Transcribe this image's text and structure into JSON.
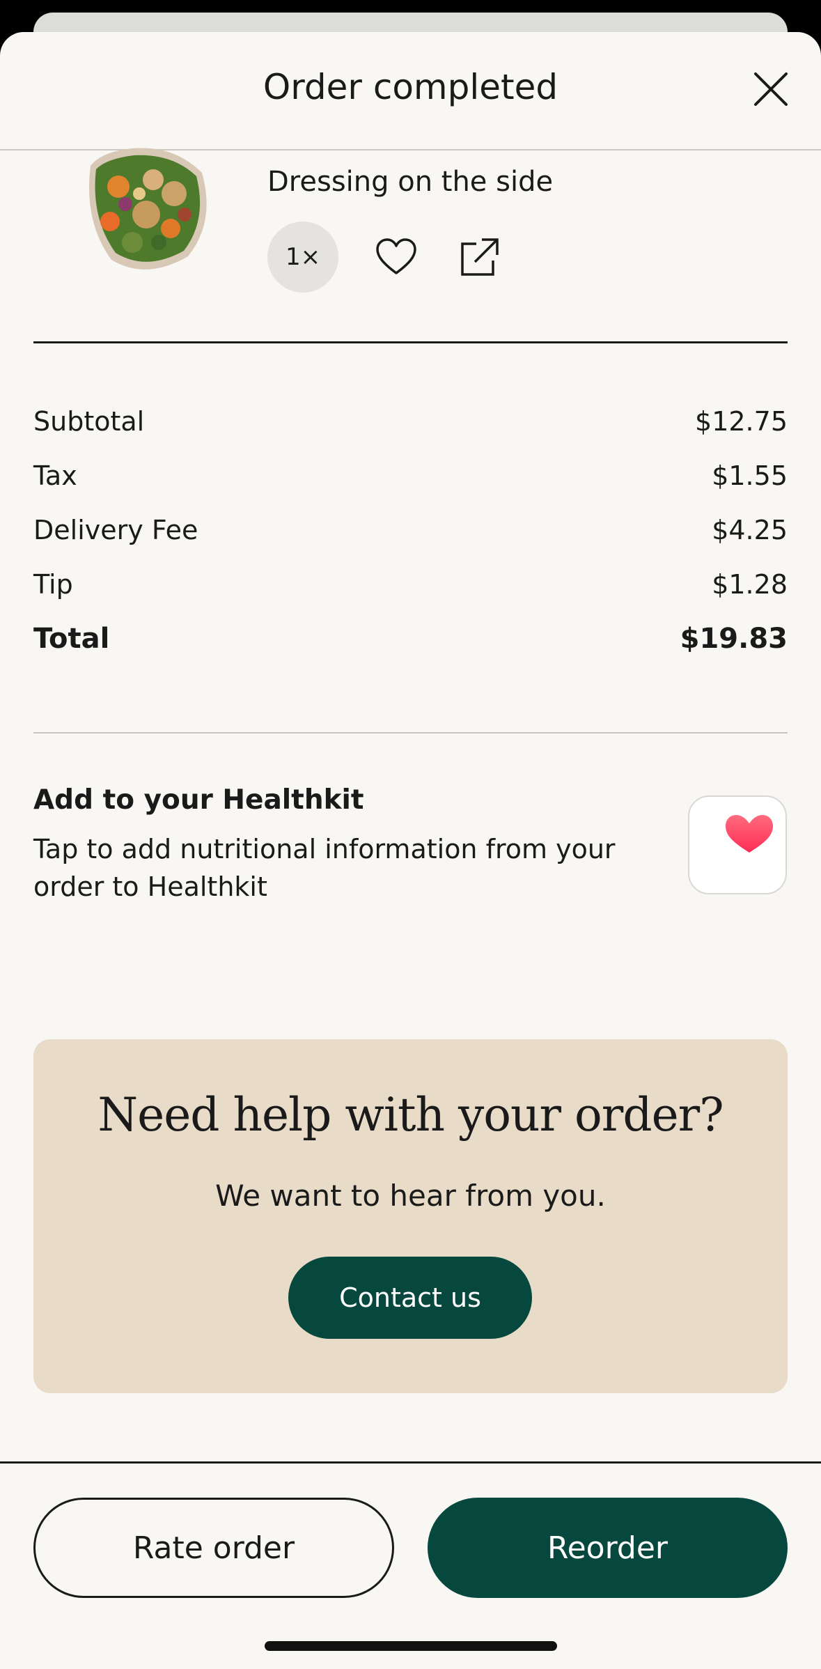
{
  "header": {
    "title": "Order completed"
  },
  "item": {
    "dressing": "Dressing on the side",
    "quantity": "1×"
  },
  "summary": {
    "rows": [
      {
        "label": "Subtotal",
        "value": "$12.75"
      },
      {
        "label": "Tax",
        "value": "$1.55"
      },
      {
        "label": "Delivery Fee",
        "value": "$4.25"
      },
      {
        "label": "Tip",
        "value": "$1.28"
      }
    ],
    "total": {
      "label": "Total",
      "value": "$19.83"
    }
  },
  "healthkit": {
    "title": "Add to your Healthkit",
    "description": "Tap to add nutritional information from your order to Healthkit",
    "icon": "health-heart-icon"
  },
  "help": {
    "title": "Need help with your order?",
    "subtitle": "We want to hear from you.",
    "contact_label": "Contact us"
  },
  "footer": {
    "rate_label": "Rate order",
    "reorder_label": "Reorder"
  },
  "colors": {
    "brand_green": "#06483e",
    "help_background": "#e8dcc8",
    "sheet_background": "#f8f7f3",
    "heart_red": "#ff3b5c"
  }
}
